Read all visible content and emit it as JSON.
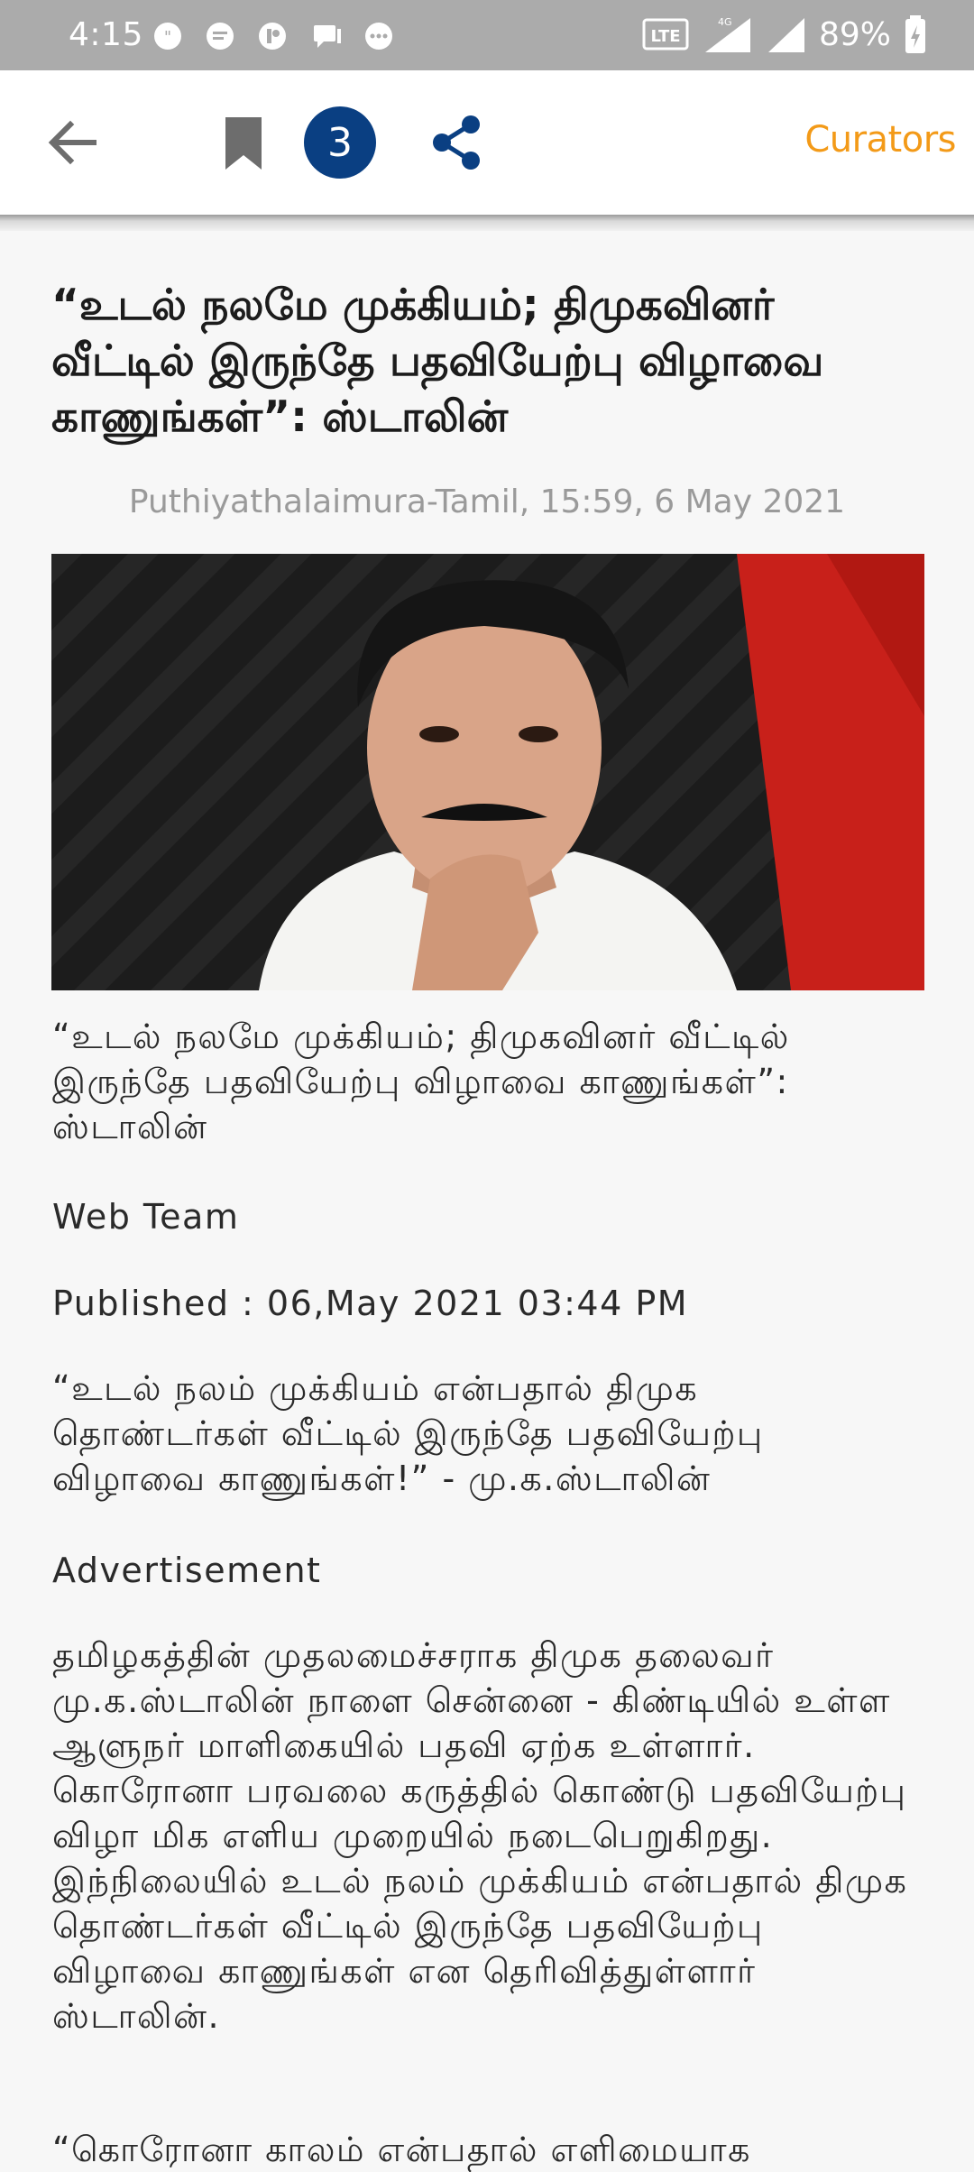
{
  "status_bar": {
    "time": "4:15",
    "network": "4G",
    "volte": "Vo LTE 1",
    "battery": "89%"
  },
  "app_bar": {
    "back_icon": "arrow-left-icon",
    "bookmark_icon": "bookmark-icon",
    "count_badge": "3",
    "share_icon": "share-icon",
    "curators_label": "Curators",
    "accent_color": "#f39a18",
    "badge_color": "#0a3f82"
  },
  "article": {
    "headline": "“உடல் நலமே முக்கியம்; திமுகவினர் வீட்டில் இருந்தே பதவியேற்பு விழாவை காணுங்கள்”: ஸ்டாலின்",
    "source_line": "Puthiyathalaimura-Tamil, 15:59, 6 May 2021",
    "caption": "“உடல் நலமே முக்கியம்; திமுகவினர் வீட்டில் இருந்தே பதவியேற்பு விழாவை காணுங்கள்”: ஸ்டாலின்",
    "author": "Web Team",
    "published": "Published : 06,May 2021 03:44 PM",
    "quote": "“உடல் நலம் முக்கியம் என்பதால் திமுக தொண்டர்கள் வீட்டில் இருந்தே பதவியேற்பு விழாவை காணுங்கள்!” - மு.க.ஸ்டாலின்",
    "advertisement": "Advertisement",
    "paragraph": "தமிழகத்தின் முதலமைச்சராக திமுக தலைவர் மு.க.ஸ்டாலின் நாளை சென்னை - கிண்டியில் உள்ள ஆளுநர் மாளிகையில் பதவி ஏற்க உள்ளார். கொரோனா பரவலை கருத்தில் கொண்டு பதவியேற்பு விழா மிக எளிய முறையில் நடைபெறுகிறது. இந்நிலையில் உடல் நலம் முக்கியம் என்பதால் திமுக தொண்டர்கள் வீட்டில் இருந்தே பதவியேற்பு விழாவை காணுங்கள் என தெரிவித்துள்ளார் ஸ்டாலின்.",
    "next_line": "“கொரோனா காலம் என்பதால் எளிமையாக"
  }
}
